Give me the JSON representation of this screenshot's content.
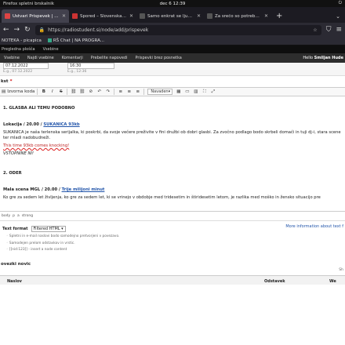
{
  "os": {
    "app_menu": "Firefox spletni brskalnik",
    "clock": "dec 6  12:39",
    "status_icons": "⏻"
  },
  "browser": {
    "tabs": [
      {
        "label": "Ustvari Prispevek | Radio",
        "active": true,
        "fav_color": "#d44"
      },
      {
        "label": "Spored – Slovenska kino",
        "active": false,
        "fav_color": "#c33"
      },
      {
        "label": "Samo enkrat se ljubi – SL",
        "active": false,
        "fav_color": "#555"
      },
      {
        "label": "Za srečo so potrebni trije",
        "active": false,
        "fav_color": "#555"
      }
    ],
    "new_tab": "+",
    "tab_list": "⌄",
    "url": "https://radiostudent.si/node/add/prispevek",
    "bookmarks": [
      "NOTEKA - picapica",
      "RŠ Chat | NA PROGRA..."
    ]
  },
  "admin": {
    "top_items": [
      "Pregledna plošča",
      "Vsebine"
    ],
    "menu_items": [
      "Vsebine",
      "Najdi vsebine",
      "Komentarji",
      "Prebelite napovedi",
      "Prispevki brez posnetka"
    ],
    "user_greeting": "Hello",
    "user_name": "Smiljan Hude"
  },
  "dates": [
    {
      "value": "07.12.2022",
      "hint": "E.g., 07.12.2022"
    },
    {
      "value": "16:30",
      "hint": "E.g., 12:36"
    }
  ],
  "tekst_label": "kst",
  "required_mark": "*",
  "editor_toolbar": {
    "source_label": "Izvorna koda",
    "buttons": [
      "B",
      "I",
      "S",
      "⛓",
      "⛓",
      "⊘",
      "↶",
      "↷",
      "≡",
      "≡",
      "≡"
    ],
    "format_label": "Navaden",
    "extra": [
      "▦",
      "▭",
      "▥",
      "⛶",
      "⤢"
    ]
  },
  "editor": {
    "section1": "1. GLASBA ALI TEMU PODOBNO",
    "loc1_prefix": "Lokacija / 20.00 / ",
    "loc1_link": "SUKANICA 93kb",
    "paragraph1": "SUKANICA je naša terlenska serijalka, ki poskrbi, da svoje večere preživite v fini družbi ob dobri glasbi. Za zvočno podlago bodo skrbeli domači in tuji dj-i, stara scene ter mladi nadobudneži.",
    "this_time": "This time 93kb comes knocking!",
    "vstopnine": "VSTOPNINE NI!",
    "section2": "2. ODER",
    "loc2_prefix": "Mala scena MGL / 20.00 / ",
    "loc2_link": "Trije milijoni minut",
    "paragraph2": "Ko gre za sedem let življenja, ko gre za sedem let, ki se vrinejo v obdobje med tridesetim in štiridesetim letom, je razlika med moško in žensko situacijo pre"
  },
  "path": [
    "body",
    "p",
    "a",
    "strong"
  ],
  "text_format": {
    "label": "Text format",
    "selected": "Filtered HTML",
    "more_info": "More information about text f",
    "tips": [
      "Spletni in e-mail naslovi bodo samodejno pretvorjeni v povezavo.",
      "Samodejen prelom odstavkov in vrstic.",
      "[[nid:123]] - insert a node content"
    ]
  },
  "related": {
    "title": "ovezki novic",
    "show": "Sh",
    "columns": [
      "Naslov",
      "Odstavek",
      "We"
    ]
  }
}
